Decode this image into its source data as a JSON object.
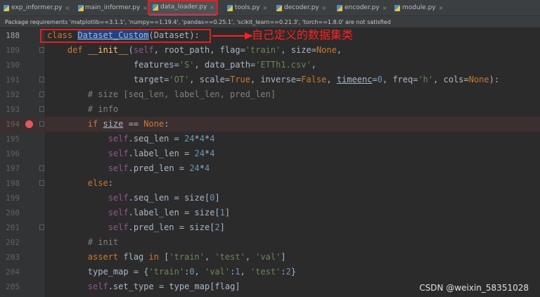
{
  "tabs": [
    {
      "label": "exp_informer.py",
      "active": false
    },
    {
      "label": "main_informer.py",
      "active": false
    },
    {
      "label": "data_loader.py",
      "active": true
    },
    {
      "label": "tools.py",
      "active": false
    },
    {
      "label": "decoder.py",
      "active": false
    },
    {
      "label": "encoder.py",
      "active": false
    },
    {
      "label": "module.py",
      "active": false
    }
  ],
  "notice": "Package requirements 'matplotlib==3.1.1', 'numpy==1.19.4', 'pandas==0.25.1', 'scikit_learn==0.21.3', 'torch==1.8.0' are not satisfied",
  "annotation": "自己定义的数据集类",
  "watermark": "CSDN @weixin_58351028",
  "colors": {
    "highlight_box": "#e02020",
    "breakpoint": "#db5c5c",
    "keyword": "#cc7832",
    "string": "#6a8759",
    "number": "#6897bb"
  },
  "code_lines": [
    {
      "num": "188",
      "text": "class Dataset_Custom(Dataset):"
    },
    {
      "num": "189",
      "text": "    def __init__(self, root_path, flag='train', size=None,"
    },
    {
      "num": "190",
      "text": "                 features='S', data_path='ETTh1.csv',"
    },
    {
      "num": "191",
      "text": "                 target='OT', scale=True, inverse=False, timeenc=0, freq='h', cols=None):"
    },
    {
      "num": "192",
      "text": "        # size [seq_len, label_len, pred_len]"
    },
    {
      "num": "193",
      "text": "        # info"
    },
    {
      "num": "194",
      "text": "        if size == None:"
    },
    {
      "num": "195",
      "text": "            self.seq_len = 24*4*4"
    },
    {
      "num": "196",
      "text": "            self.label_len = 24*4"
    },
    {
      "num": "197",
      "text": "            self.pred_len = 24*4"
    },
    {
      "num": "198",
      "text": "        else:"
    },
    {
      "num": "199",
      "text": "            self.seq_len = size[0]"
    },
    {
      "num": "200",
      "text": "            self.label_len = size[1]"
    },
    {
      "num": "201",
      "text": "            self.pred_len = size[2]"
    },
    {
      "num": "202",
      "text": "        # init"
    },
    {
      "num": "203",
      "text": "        assert flag in ['train', 'test', 'val']"
    },
    {
      "num": "204",
      "text": "        type_map = {'train':0, 'val':1, 'test':2}"
    },
    {
      "num": "205",
      "text": "        self.set_type = type_map[flag]"
    }
  ]
}
